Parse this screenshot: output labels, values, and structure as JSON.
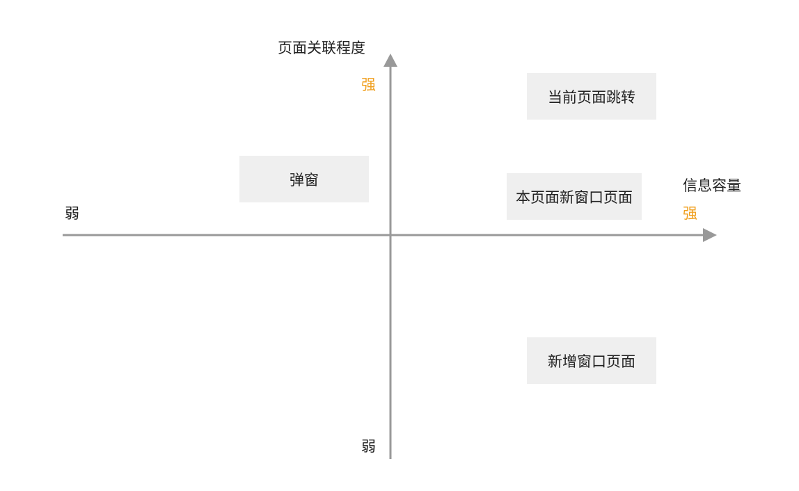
{
  "y_axis": {
    "title": "页面关联程度",
    "high_label": "强",
    "low_label": "弱"
  },
  "x_axis": {
    "title": "信息容量",
    "high_label": "强",
    "low_label": "弱"
  },
  "boxes": {
    "current_page_jump": "当前页面跳转",
    "popup": "弹窗",
    "new_window_this_page": "本页面新窗口页面",
    "add_new_window_page": "新增窗口页面"
  },
  "colors": {
    "axis": "#999999",
    "strong_label": "#f0a020",
    "box_fill": "#efefef"
  }
}
